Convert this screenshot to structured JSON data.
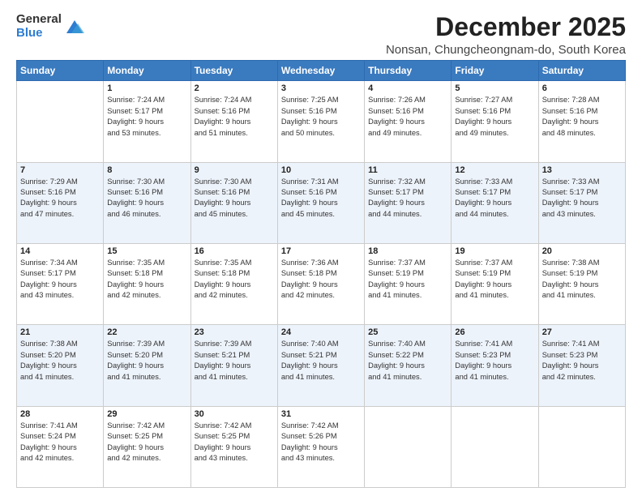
{
  "logo": {
    "general": "General",
    "blue": "Blue"
  },
  "title": "December 2025",
  "location": "Nonsan, Chungcheongnam-do, South Korea",
  "days_of_week": [
    "Sunday",
    "Monday",
    "Tuesday",
    "Wednesday",
    "Thursday",
    "Friday",
    "Saturday"
  ],
  "weeks": [
    [
      {
        "day": "",
        "info": ""
      },
      {
        "day": "1",
        "info": "Sunrise: 7:24 AM\nSunset: 5:17 PM\nDaylight: 9 hours\nand 53 minutes."
      },
      {
        "day": "2",
        "info": "Sunrise: 7:24 AM\nSunset: 5:16 PM\nDaylight: 9 hours\nand 51 minutes."
      },
      {
        "day": "3",
        "info": "Sunrise: 7:25 AM\nSunset: 5:16 PM\nDaylight: 9 hours\nand 50 minutes."
      },
      {
        "day": "4",
        "info": "Sunrise: 7:26 AM\nSunset: 5:16 PM\nDaylight: 9 hours\nand 49 minutes."
      },
      {
        "day": "5",
        "info": "Sunrise: 7:27 AM\nSunset: 5:16 PM\nDaylight: 9 hours\nand 49 minutes."
      },
      {
        "day": "6",
        "info": "Sunrise: 7:28 AM\nSunset: 5:16 PM\nDaylight: 9 hours\nand 48 minutes."
      }
    ],
    [
      {
        "day": "7",
        "info": "Sunrise: 7:29 AM\nSunset: 5:16 PM\nDaylight: 9 hours\nand 47 minutes."
      },
      {
        "day": "8",
        "info": "Sunrise: 7:30 AM\nSunset: 5:16 PM\nDaylight: 9 hours\nand 46 minutes."
      },
      {
        "day": "9",
        "info": "Sunrise: 7:30 AM\nSunset: 5:16 PM\nDaylight: 9 hours\nand 45 minutes."
      },
      {
        "day": "10",
        "info": "Sunrise: 7:31 AM\nSunset: 5:16 PM\nDaylight: 9 hours\nand 45 minutes."
      },
      {
        "day": "11",
        "info": "Sunrise: 7:32 AM\nSunset: 5:17 PM\nDaylight: 9 hours\nand 44 minutes."
      },
      {
        "day": "12",
        "info": "Sunrise: 7:33 AM\nSunset: 5:17 PM\nDaylight: 9 hours\nand 44 minutes."
      },
      {
        "day": "13",
        "info": "Sunrise: 7:33 AM\nSunset: 5:17 PM\nDaylight: 9 hours\nand 43 minutes."
      }
    ],
    [
      {
        "day": "14",
        "info": "Sunrise: 7:34 AM\nSunset: 5:17 PM\nDaylight: 9 hours\nand 43 minutes."
      },
      {
        "day": "15",
        "info": "Sunrise: 7:35 AM\nSunset: 5:18 PM\nDaylight: 9 hours\nand 42 minutes."
      },
      {
        "day": "16",
        "info": "Sunrise: 7:35 AM\nSunset: 5:18 PM\nDaylight: 9 hours\nand 42 minutes."
      },
      {
        "day": "17",
        "info": "Sunrise: 7:36 AM\nSunset: 5:18 PM\nDaylight: 9 hours\nand 42 minutes."
      },
      {
        "day": "18",
        "info": "Sunrise: 7:37 AM\nSunset: 5:19 PM\nDaylight: 9 hours\nand 41 minutes."
      },
      {
        "day": "19",
        "info": "Sunrise: 7:37 AM\nSunset: 5:19 PM\nDaylight: 9 hours\nand 41 minutes."
      },
      {
        "day": "20",
        "info": "Sunrise: 7:38 AM\nSunset: 5:19 PM\nDaylight: 9 hours\nand 41 minutes."
      }
    ],
    [
      {
        "day": "21",
        "info": "Sunrise: 7:38 AM\nSunset: 5:20 PM\nDaylight: 9 hours\nand 41 minutes."
      },
      {
        "day": "22",
        "info": "Sunrise: 7:39 AM\nSunset: 5:20 PM\nDaylight: 9 hours\nand 41 minutes."
      },
      {
        "day": "23",
        "info": "Sunrise: 7:39 AM\nSunset: 5:21 PM\nDaylight: 9 hours\nand 41 minutes."
      },
      {
        "day": "24",
        "info": "Sunrise: 7:40 AM\nSunset: 5:21 PM\nDaylight: 9 hours\nand 41 minutes."
      },
      {
        "day": "25",
        "info": "Sunrise: 7:40 AM\nSunset: 5:22 PM\nDaylight: 9 hours\nand 41 minutes."
      },
      {
        "day": "26",
        "info": "Sunrise: 7:41 AM\nSunset: 5:23 PM\nDaylight: 9 hours\nand 41 minutes."
      },
      {
        "day": "27",
        "info": "Sunrise: 7:41 AM\nSunset: 5:23 PM\nDaylight: 9 hours\nand 42 minutes."
      }
    ],
    [
      {
        "day": "28",
        "info": "Sunrise: 7:41 AM\nSunset: 5:24 PM\nDaylight: 9 hours\nand 42 minutes."
      },
      {
        "day": "29",
        "info": "Sunrise: 7:42 AM\nSunset: 5:25 PM\nDaylight: 9 hours\nand 42 minutes."
      },
      {
        "day": "30",
        "info": "Sunrise: 7:42 AM\nSunset: 5:25 PM\nDaylight: 9 hours\nand 43 minutes."
      },
      {
        "day": "31",
        "info": "Sunrise: 7:42 AM\nSunset: 5:26 PM\nDaylight: 9 hours\nand 43 minutes."
      },
      {
        "day": "",
        "info": ""
      },
      {
        "day": "",
        "info": ""
      },
      {
        "day": "",
        "info": ""
      }
    ]
  ]
}
